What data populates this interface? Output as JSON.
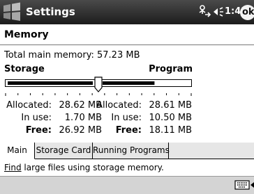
{
  "titlebar": {
    "title": "Settings",
    "clock": "1:43",
    "ok_label": "ok",
    "icons": [
      "windows-start-icon",
      "connectivity-icon",
      "volume-icon"
    ]
  },
  "page": {
    "title": "Memory",
    "total_label": "Total main memory:",
    "total_value": "57.23 MB"
  },
  "storage": {
    "header": "Storage",
    "allocated_label": "Allocated:",
    "allocated": "28.62 MB",
    "inuse_label": "In use:",
    "inuse": "1.70 MB",
    "free_label": "Free:",
    "free": "26.92 MB"
  },
  "program": {
    "header": "Program",
    "allocated_label": "Allocated:",
    "allocated": "28.61 MB",
    "inuse_label": "In use:",
    "inuse": "10.50 MB",
    "free_label": "Free:",
    "free": "18.11 MB"
  },
  "slider": {
    "storage_fraction": 0.5,
    "storage_used_fraction": 0.059,
    "program_used_fraction": 0.367
  },
  "tabs": [
    {
      "label": "Main",
      "active": true
    },
    {
      "label": "Storage Card",
      "active": false
    },
    {
      "label": "Running Programs",
      "active": false
    }
  ],
  "find_line": {
    "link": "Find",
    "rest": " large files using storage memory."
  },
  "menubar": {
    "icons": [
      "keyboard-icon",
      "input-panel-arrow-icon"
    ]
  },
  "colors": {
    "titlebar": "#2a2a2a",
    "menubar": "#d4d4d4",
    "inactive_tab": "#e6e6e6"
  }
}
